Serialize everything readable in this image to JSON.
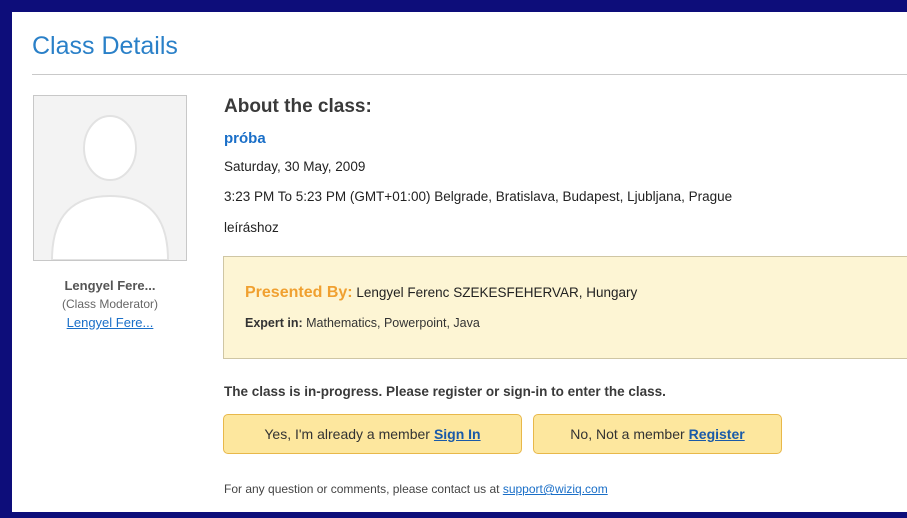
{
  "page": {
    "title": "Class Details"
  },
  "moderator": {
    "name": "Lengyel Fere...",
    "role": "(Class Moderator)",
    "link": "Lengyel Fere..."
  },
  "about": {
    "heading": "About the class:",
    "class_name": "próba",
    "date": "Saturday, 30 May, 2009",
    "time": "3:23 PM To 5:23 PM (GMT+01:00) Belgrade, Bratislava, Budapest, Ljubljana, Prague",
    "description": "leíráshoz"
  },
  "presenter": {
    "label": "Presented By:",
    "name": "Lengyel Ferenc",
    "location": "SZEKESFEHERVAR, Hungary",
    "expert_label": "Expert in:",
    "expert_value": "Mathematics, Powerpoint, Java"
  },
  "status": {
    "text": "The class is in-progress. Please register or sign-in to enter the class."
  },
  "buttons": {
    "signin_prefix": "Yes, I'm already a member",
    "signin_link": "Sign In",
    "register_prefix": "No, Not a member",
    "register_link": "Register"
  },
  "contact": {
    "text": "For any question or comments, please contact us at",
    "email": "support@wiziq.com"
  },
  "colors": {
    "frame": "#0d0d7a",
    "title": "#2a80c8",
    "link": "#1a6fc8",
    "presenter_bg": "#fdf5d4",
    "presented_label": "#f0a030",
    "button_bg": "#fde79e"
  },
  "icons": {
    "avatar": "default-user-silhouette"
  }
}
